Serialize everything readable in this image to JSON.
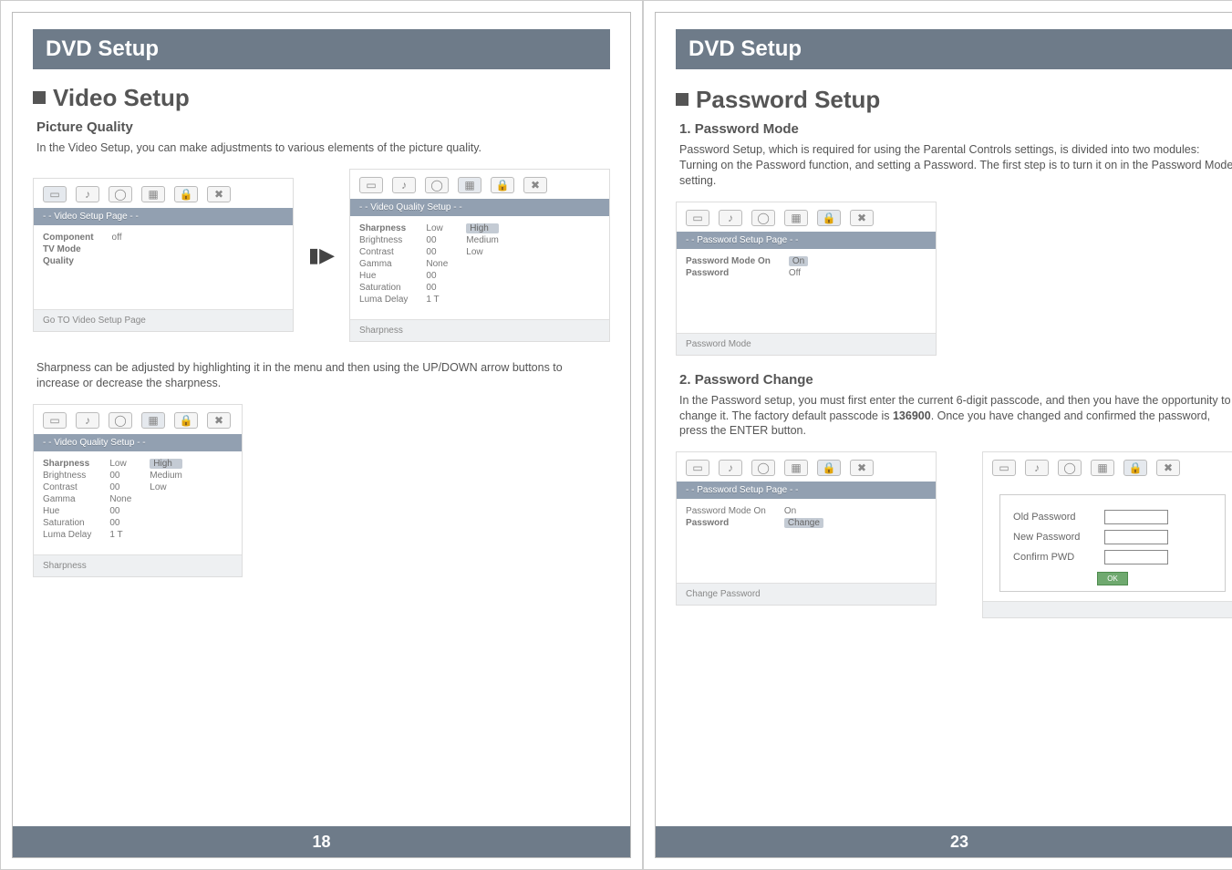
{
  "left": {
    "titleBar": "DVD Setup",
    "section": "Video Setup",
    "sub1": "Picture Quality",
    "intro": "In the Video Setup, you can make adjustments to various elements of the picture quality.",
    "shot1": {
      "band": "- - Video Setup Page - -",
      "items": {
        "a": "Component",
        "b": "TV Mode",
        "c": "Quality"
      },
      "val": "off",
      "footer": "Go TO Video Setup Page"
    },
    "shot2": {
      "band": "- - Video Quality Setup - -",
      "labels": {
        "a": "Sharpness",
        "b": "Brightness",
        "c": "Contrast",
        "d": "Gamma",
        "e": "Hue",
        "f": "Saturation",
        "g": "Luma Delay"
      },
      "vals": {
        "a": "Low",
        "b": "00",
        "c": "00",
        "d": "None",
        "e": "00",
        "f": "00",
        "g": "1 T"
      },
      "opts": {
        "a": "High",
        "b": "Medium",
        "c": "Low"
      },
      "footer": "Sharpness"
    },
    "mid": "Sharpness can be adjusted by highlighting it in the menu and then using the UP/DOWN arrow buttons to increase or decrease the sharpness.",
    "shot3": {
      "band": "- - Video Quality Setup - -",
      "labels": {
        "a": "Sharpness",
        "b": "Brightness",
        "c": "Contrast",
        "d": "Gamma",
        "e": "Hue",
        "f": "Saturation",
        "g": "Luma Delay"
      },
      "vals": {
        "a": "Low",
        "b": "00",
        "c": "00",
        "d": "None",
        "e": "00",
        "f": "00",
        "g": "1 T"
      },
      "opts": {
        "a": "High",
        "b": "Medium",
        "c": "Low"
      },
      "footer": "Sharpness"
    },
    "pageNum": "18"
  },
  "right": {
    "titleBar": "DVD Setup",
    "section": "Password Setup",
    "sub1": "1. Password Mode",
    "p1": "Password Setup, which is required for using the Parental Controls settings, is divided into two modules: Turning on the Password function, and setting a Password. The first step is to turn it on in the Password Mode setting.",
    "shotA": {
      "band": "- - Password Setup Page - -",
      "items": {
        "a": "Password Mode On",
        "b": "Password"
      },
      "vals": {
        "a": "On",
        "b": "Off"
      },
      "footer": "Password Mode"
    },
    "sub2": "2. Password Change",
    "p2a": "In the Password setup, you must first enter the current 6-digit passcode, and then you have the opportunity to change it. The factory default passcode is ",
    "p2code": "136900",
    "p2b": ". Once you have changed and confirmed the password, press the ENTER button.",
    "shotB": {
      "band": "- - Password Setup Page - -",
      "items": {
        "a": "Password Mode On",
        "b": "Password"
      },
      "vals": {
        "a": "On",
        "b": "Change"
      },
      "footer": "Change Password"
    },
    "pwdBox": {
      "a": "Old Password",
      "b": "New Password",
      "c": "Confirm PWD",
      "ok": "OK"
    },
    "pageNum": "23"
  },
  "icons": {
    "gen": "⎚",
    "spk": "🔊",
    "globe": "🌐",
    "kbd": "⌨",
    "lock": "🔒",
    "cog": "✖"
  }
}
